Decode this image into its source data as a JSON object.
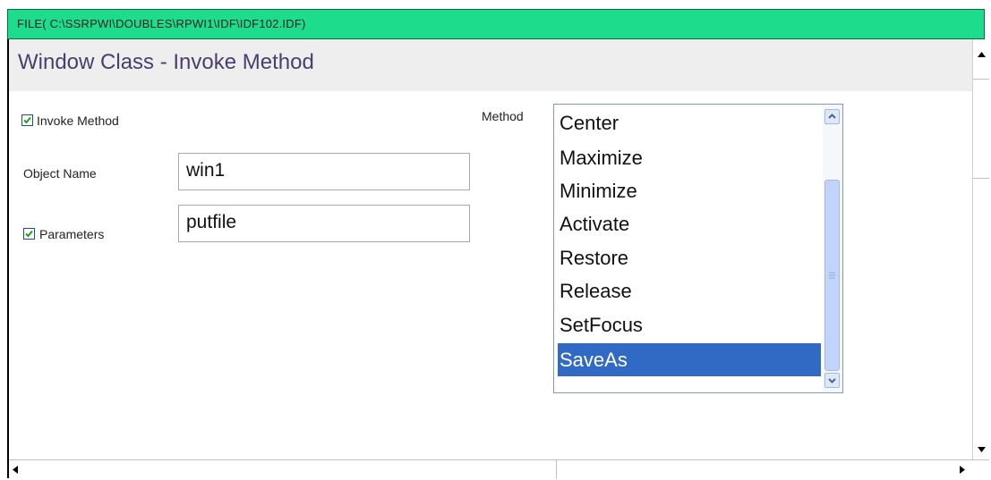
{
  "titlebar": {
    "path": "FILE( C:\\SSRPWI\\DOUBLES\\RPWI1\\IDF\\IDF102.IDF)"
  },
  "header": {
    "title": "Window Class - Invoke Method"
  },
  "form": {
    "invoke_method": {
      "label": "Invoke Method",
      "checked": true
    },
    "object_name": {
      "label": "Object Name",
      "value": "win1"
    },
    "parameters": {
      "label": "Parameters",
      "checked": true,
      "value": "putfile"
    },
    "method": {
      "label": "Method",
      "items": [
        "Center",
        "Maximize",
        "Minimize",
        "Activate",
        "Restore",
        "Release",
        "SetFocus",
        "SaveAs"
      ],
      "selected": "SaveAs"
    }
  },
  "colors": {
    "titlebar": "#1ddd8c",
    "selection": "#316ac5",
    "header_text": "#4a3f6b"
  }
}
